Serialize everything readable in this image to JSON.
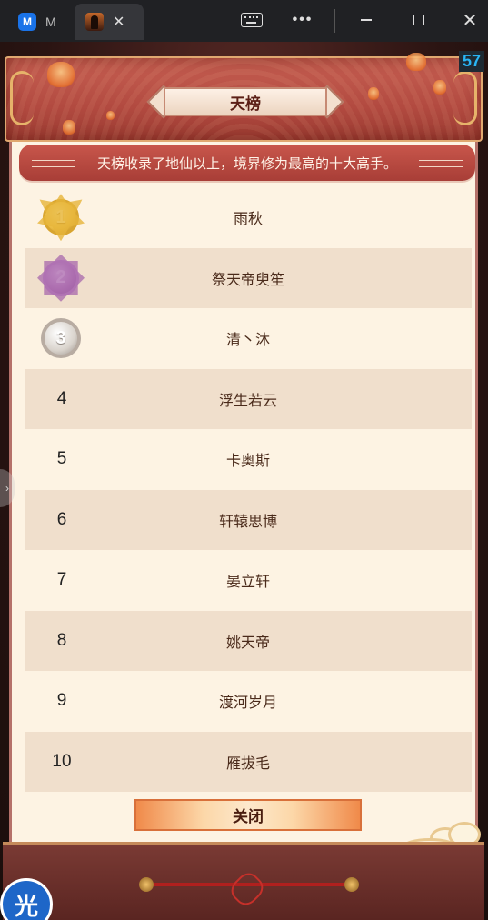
{
  "browser": {
    "tab1_label": "M",
    "tab1_logo": "M",
    "tab2_close": "✕",
    "dots": "•••",
    "close_symbol": "✕"
  },
  "game": {
    "fps": "57",
    "title": "天榜",
    "description": "天榜收录了地仙以上，境界修为最高的十大高手。",
    "close_label": "关闭",
    "app_badge": "光"
  },
  "ranks": [
    {
      "rank": "1",
      "name": "雨秋",
      "medal": "gold"
    },
    {
      "rank": "2",
      "name": "祭天帝臾笙",
      "medal": "purple"
    },
    {
      "rank": "3",
      "name": "清丶沐",
      "medal": "silver"
    },
    {
      "rank": "4",
      "name": "浮生若云"
    },
    {
      "rank": "5",
      "name": "卡奥斯"
    },
    {
      "rank": "6",
      "name": "轩辕思博"
    },
    {
      "rank": "7",
      "name": "晏立轩"
    },
    {
      "rank": "8",
      "name": "姚天帝"
    },
    {
      "rank": "9",
      "name": "渡河岁月"
    },
    {
      "rank": "10",
      "name": "雁拔毛"
    }
  ],
  "colors": {
    "panel_bg": "#fdf3e3",
    "row_alt": "#f0dfcc",
    "banner": "#b84a41",
    "fps": "#29b6f6"
  }
}
